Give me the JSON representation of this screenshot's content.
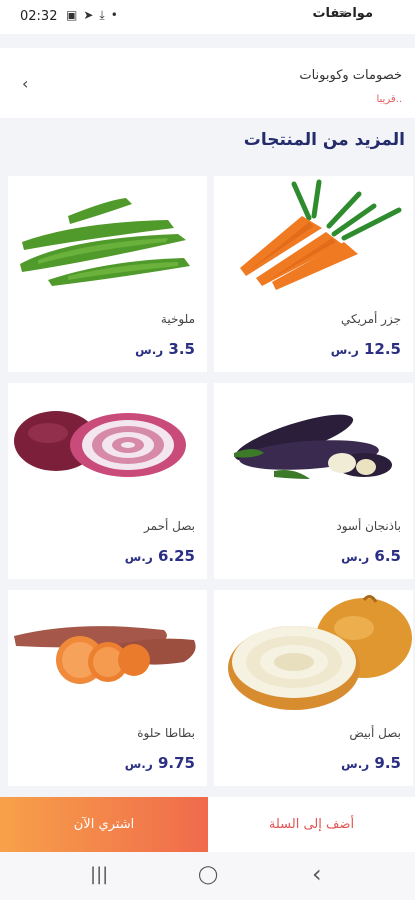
{
  "status_bar": {
    "time": "02:32",
    "app_name": "مواصفات",
    "icons": [
      "image-icon",
      "telegram-icon",
      "download-icon",
      "dot-icon"
    ]
  },
  "coupons": {
    "title": "خصومات وكوبونات",
    "subtitle": "قريبا.."
  },
  "section": {
    "title": "المزيد من المنتجات"
  },
  "products": [
    {
      "name": "جزر أمريكي",
      "price": "12.5",
      "currency": "ر.س"
    },
    {
      "name": "ملوخية",
      "price": "3.5",
      "currency": "ر.س"
    },
    {
      "name": "باذنجان أسود",
      "price": "6.5",
      "currency": "ر.س"
    },
    {
      "name": "بصل أحمر",
      "price": "6.25",
      "currency": "ر.س"
    },
    {
      "name": "بصل أبيض",
      "price": "9.5",
      "currency": "ر.س"
    },
    {
      "name": "بطاطا حلوة",
      "price": "9.75",
      "currency": "ر.س"
    }
  ],
  "actions": {
    "add_to_cart": "أضف إلى السلة",
    "buy_now": "اشتري الآن"
  },
  "nav": {
    "recents": "|||",
    "home": "◯",
    "back": "‹"
  },
  "colors": {
    "accent": "#2a2f82",
    "coupon_sub": "#e35d5d",
    "buy_gradient_start": "#f7a14a",
    "buy_gradient_end": "#f06a4b"
  }
}
